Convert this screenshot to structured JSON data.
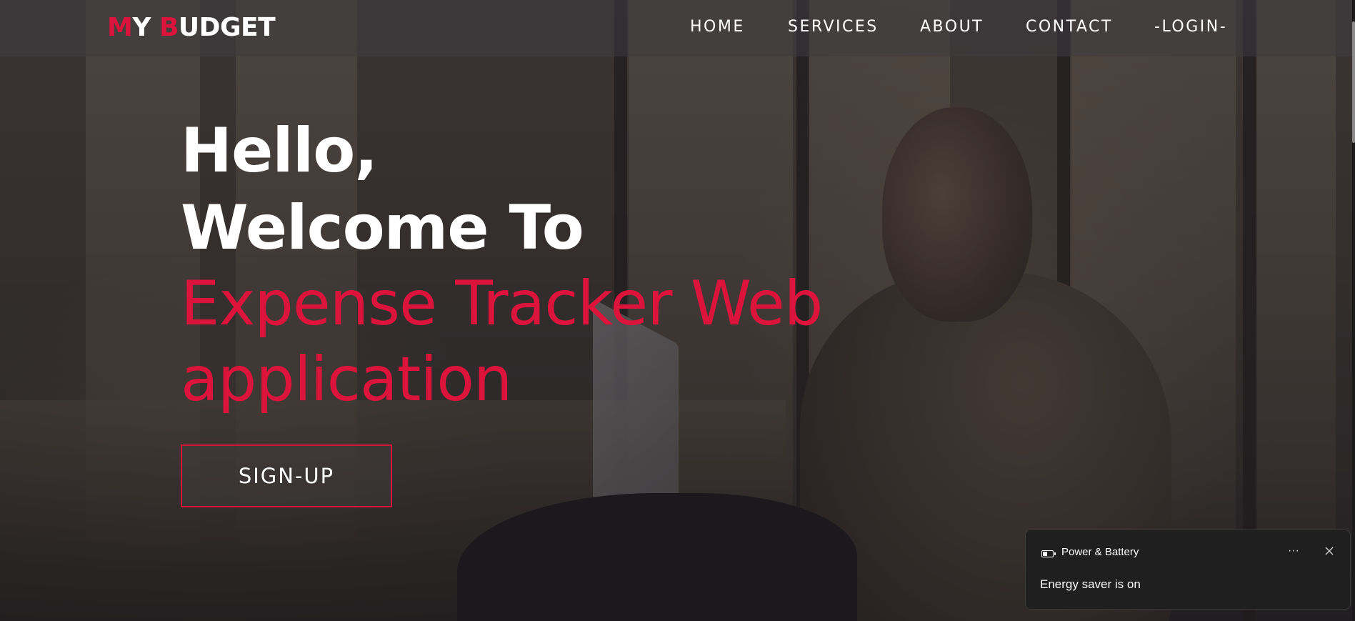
{
  "brand": {
    "letters": [
      {
        "text": "M",
        "accent": true
      },
      {
        "text": "Y ",
        "accent": false
      },
      {
        "text": "B",
        "accent": true
      },
      {
        "text": "UDGET",
        "accent": false
      }
    ]
  },
  "nav": {
    "items": [
      {
        "label": "HOME"
      },
      {
        "label": "SERVICES"
      },
      {
        "label": "ABOUT"
      },
      {
        "label": "CONTACT"
      },
      {
        "label": "-LOGIN-"
      }
    ]
  },
  "hero": {
    "line1": "Hello,",
    "line2": "Welcome To",
    "line3": "Expense Tracker Web",
    "line4": "application",
    "signup_label": "SIGN-UP"
  },
  "notification": {
    "title": "Power & Battery",
    "more_label": "···",
    "body": "Energy saver is on",
    "icons": [
      "battery-icon",
      "more-icon",
      "close-icon"
    ]
  },
  "colors": {
    "accent": "#dc143c",
    "text": "#ffffff",
    "toast_bg": "#1f1f1f"
  }
}
